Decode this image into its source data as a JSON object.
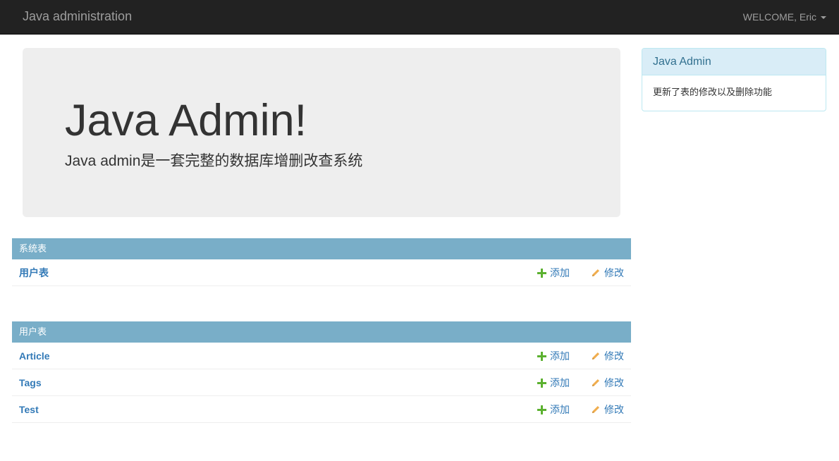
{
  "navbar": {
    "brand": "Java administration",
    "user_menu": "WELCOME, Eric"
  },
  "jumbotron": {
    "title": "Java Admin!",
    "lead": "Java admin是一套完整的数据库增删改查系统"
  },
  "side_panel": {
    "heading": "Java Admin",
    "body": "更新了表的修改以及删除功能"
  },
  "modules": [
    {
      "caption": "系统表",
      "rows": [
        {
          "name": "用户表",
          "add_label": "添加",
          "edit_label": "修改"
        }
      ]
    },
    {
      "caption": "用户表",
      "rows": [
        {
          "name": "Article",
          "add_label": "添加",
          "edit_label": "修改"
        },
        {
          "name": "Tags",
          "add_label": "添加",
          "edit_label": "修改"
        },
        {
          "name": "Test",
          "add_label": "添加",
          "edit_label": "修改"
        }
      ]
    }
  ],
  "colors": {
    "navbar_bg": "#222222",
    "module_caption_bg": "#79aec8",
    "link": "#337ab7",
    "add_icon": "#5cb130",
    "edit_icon": "#f0ad4e",
    "panel_heading_bg": "#d9edf7"
  },
  "icons": {
    "add": "plus-icon",
    "edit": "pencil-icon",
    "user_menu": "caret-down-icon"
  }
}
